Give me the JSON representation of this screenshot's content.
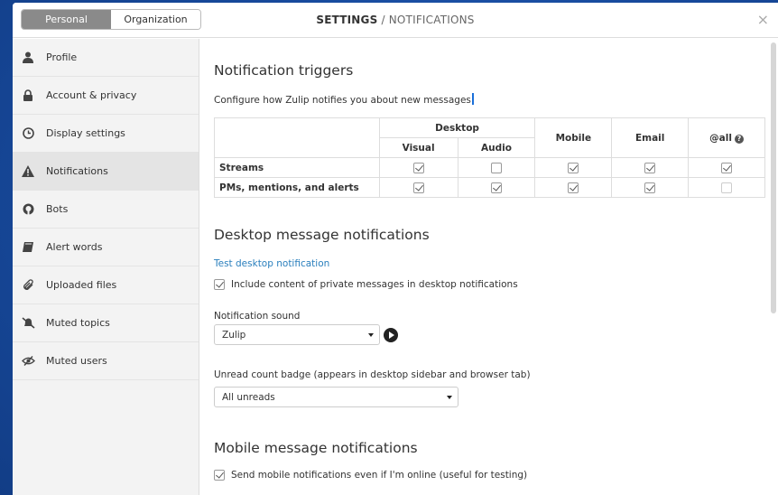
{
  "header": {
    "tabs": [
      {
        "label": "Personal"
      },
      {
        "label": "Organization"
      }
    ],
    "title_main": "SETTINGS",
    "title_sub": " / NOTIFICATIONS",
    "close": "×"
  },
  "sidebar": {
    "items": [
      {
        "label": "Profile",
        "icon": "user-icon"
      },
      {
        "label": "Account & privacy",
        "icon": "lock-icon"
      },
      {
        "label": "Display settings",
        "icon": "clock-icon"
      },
      {
        "label": "Notifications",
        "icon": "warning-icon"
      },
      {
        "label": "Bots",
        "icon": "github-icon"
      },
      {
        "label": "Alert words",
        "icon": "book-icon"
      },
      {
        "label": "Uploaded files",
        "icon": "paperclip-icon"
      },
      {
        "label": "Muted topics",
        "icon": "bell-slash-icon"
      },
      {
        "label": "Muted users",
        "icon": "eye-slash-icon"
      }
    ]
  },
  "triggers": {
    "heading": "Notification triggers",
    "description": "Configure how Zulip notifies you about new messages",
    "col_desktop": "Desktop",
    "col_visual": "Visual",
    "col_audio": "Audio",
    "col_mobile": "Mobile",
    "col_email": "Email",
    "col_all": "@all",
    "rows": [
      {
        "label": "Streams"
      },
      {
        "label": "PMs, mentions, and alerts"
      }
    ]
  },
  "desktop": {
    "heading": "Desktop message notifications",
    "test_link": "Test desktop notification",
    "include_content": "Include content of private messages in desktop notifications",
    "sound_label": "Notification sound",
    "sound_value": "Zulip",
    "badge_label": "Unread count badge (appears in desktop sidebar and browser tab)",
    "badge_value": "All unreads"
  },
  "mobile": {
    "heading": "Mobile message notifications",
    "send_online": "Send mobile notifications even if I'm online (useful for testing)"
  },
  "colors": {
    "accent_link": "#2a7fbd",
    "active_tab": "#8a8a8a",
    "backdrop": "#1b4f9e"
  }
}
